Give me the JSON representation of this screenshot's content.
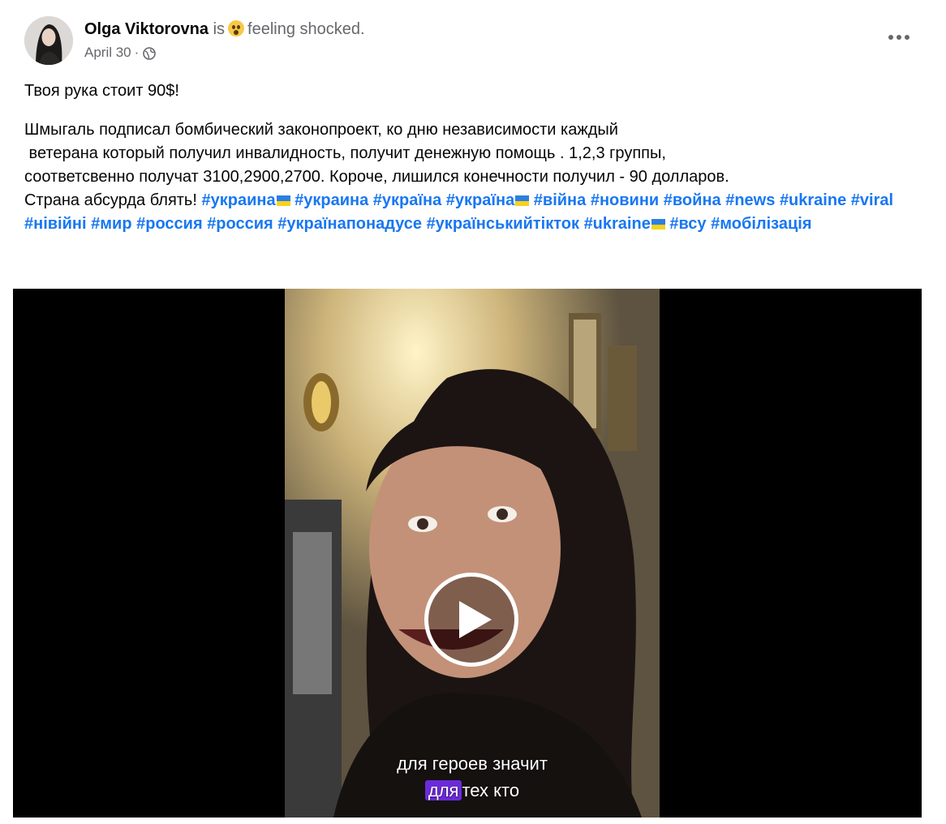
{
  "post": {
    "author": "Olga Viktorovna",
    "activity_prefix": "is",
    "feeling_icon": "shocked-face-emoji",
    "feeling_text": "feeling shocked.",
    "date": "April 30",
    "date_separator": "·",
    "audience_icon": "globe-icon",
    "more_icon": "more-options-icon",
    "title": "Твоя рука стоит 90$!",
    "body_lines": [
      "Шмыгаль подписал бомбический законопроект,  ко дню независимости каждый",
      " ветерана который получил инвалидность, получит денежную помощь . 1,2,3 группы,",
      "соответсвенно получат 3100,2900,2700. Короче, лишился конечности получил - 90 долларов."
    ],
    "body_tail": "Страна абсурда блять! ",
    "hashtags": [
      {
        "text": "#украина",
        "flag": true
      },
      {
        "text": "#украина",
        "flag": false
      },
      {
        "text": "#україна",
        "flag": false
      },
      {
        "text": "#україна",
        "flag": true
      },
      {
        "text": "#війна",
        "flag": false
      },
      {
        "text": "#новини",
        "flag": false
      },
      {
        "text": "#война",
        "flag": false
      },
      {
        "text": "#news",
        "flag": false
      },
      {
        "text": "#ukraine",
        "flag": false
      },
      {
        "text": "#viral",
        "flag": false
      },
      {
        "text": "#нівійні",
        "flag": false
      },
      {
        "text": "#мир",
        "flag": false
      },
      {
        "text": "#россия",
        "flag": false
      },
      {
        "text": "#россия",
        "flag": false
      },
      {
        "text": "#українапонадусе",
        "flag": false
      },
      {
        "text": "#українськийтікток",
        "flag": false
      },
      {
        "text": "#ukraine",
        "flag": true
      },
      {
        "text": "#всу",
        "flag": false
      },
      {
        "text": "#мобілізація",
        "flag": false
      }
    ],
    "hashtag_color": "#1877f2"
  },
  "video": {
    "play_icon": "play-icon",
    "subtitle_line1": "для героев значит",
    "subtitle_line2_highlight": "для",
    "subtitle_line2_rest": "тех кто",
    "highlight_color": "#6c2bd9"
  }
}
